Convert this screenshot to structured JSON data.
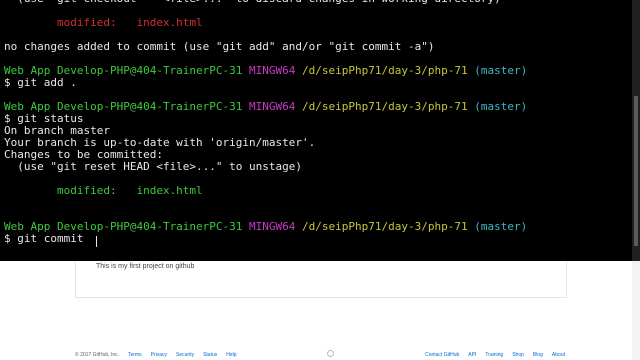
{
  "terminal": {
    "lines": [
      {
        "segments": [
          {
            "text": "  (use \"git checkout -- <file>...\" to discard changes in working directory)",
            "color": "white"
          }
        ]
      },
      {
        "segments": []
      },
      {
        "segments": [
          {
            "text": "        modified:   index.html",
            "color": "red"
          }
        ]
      },
      {
        "segments": []
      },
      {
        "segments": [
          {
            "text": "no changes added to commit (use \"git add\" and/or \"git commit -a\")",
            "color": "white"
          }
        ]
      },
      {
        "segments": []
      },
      {
        "segments": [
          {
            "text": "Web App Develop-PHP@404-TrainerPC-31 ",
            "color": "green"
          },
          {
            "text": "MINGW64 ",
            "color": "magenta"
          },
          {
            "text": "/d/seipPhp71/day-3/php-71 ",
            "color": "yellow"
          },
          {
            "text": "(master)",
            "color": "cyan"
          }
        ]
      },
      {
        "segments": [
          {
            "text": "$ git add .",
            "color": "white"
          }
        ]
      },
      {
        "segments": []
      },
      {
        "segments": [
          {
            "text": "Web App Develop-PHP@404-TrainerPC-31 ",
            "color": "green"
          },
          {
            "text": "MINGW64 ",
            "color": "magenta"
          },
          {
            "text": "/d/seipPhp71/day-3/php-71 ",
            "color": "yellow"
          },
          {
            "text": "(master)",
            "color": "cyan"
          }
        ]
      },
      {
        "segments": [
          {
            "text": "$ git status",
            "color": "white"
          }
        ]
      },
      {
        "segments": [
          {
            "text": "On branch master",
            "color": "white"
          }
        ]
      },
      {
        "segments": [
          {
            "text": "Your branch is up-to-date with 'origin/master'.",
            "color": "white"
          }
        ]
      },
      {
        "segments": [
          {
            "text": "Changes to be committed:",
            "color": "white"
          }
        ]
      },
      {
        "segments": [
          {
            "text": "  (use \"git reset HEAD <file>...\" to unstage)",
            "color": "white"
          }
        ]
      },
      {
        "segments": []
      },
      {
        "segments": [
          {
            "text": "        modified:   index.html",
            "color": "green"
          }
        ]
      },
      {
        "segments": []
      },
      {
        "segments": []
      },
      {
        "segments": [
          {
            "text": "Web App Develop-PHP@404-TrainerPC-31 ",
            "color": "green"
          },
          {
            "text": "MINGW64 ",
            "color": "magenta"
          },
          {
            "text": "/d/seipPhp71/day-3/php-71 ",
            "color": "yellow"
          },
          {
            "text": "(master)",
            "color": "cyan"
          }
        ]
      },
      {
        "segments": [
          {
            "text": "$ git commit",
            "color": "white"
          }
        ]
      }
    ]
  },
  "github_page": {
    "readme_text": "This is my first project on github",
    "footer_left": [
      "© 2017 GitHub, Inc.",
      "Terms",
      "Privacy",
      "Security",
      "Status",
      "Help"
    ],
    "footer_right": [
      "Contact GitHub",
      "API",
      "Training",
      "Shop",
      "Blog",
      "About"
    ],
    "footer_mark_icon": "github-octocat-icon"
  }
}
